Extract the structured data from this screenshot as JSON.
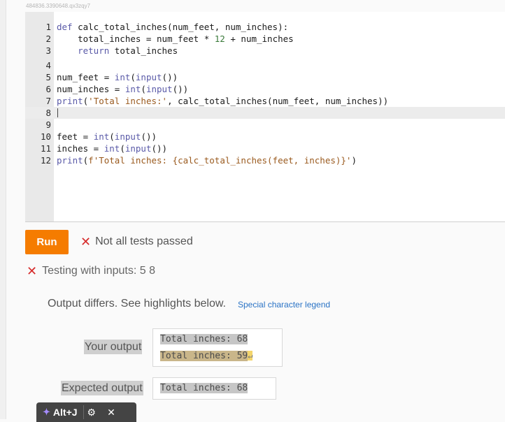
{
  "watermark": "484836.3390648.qx3zqy7",
  "editor": {
    "lines": [
      {
        "n": "1",
        "code": "def calc_total_inches(num_feet, num_inches):"
      },
      {
        "n": "2",
        "code": "    total_inches = num_feet * 12 + num_inches"
      },
      {
        "n": "3",
        "code": "    return total_inches"
      },
      {
        "n": "4",
        "code": ""
      },
      {
        "n": "5",
        "code": "num_feet = int(input())"
      },
      {
        "n": "6",
        "code": "num_inches = int(input())"
      },
      {
        "n": "7",
        "code": "print('Total inches:', calc_total_inches(num_feet, num_inches))"
      },
      {
        "n": "8",
        "code": ""
      },
      {
        "n": "9",
        "code": ""
      },
      {
        "n": "10",
        "code": "feet = int(input())"
      },
      {
        "n": "11",
        "code": "inches = int(input())"
      },
      {
        "n": "12",
        "code": "print(f'Total inches: {calc_total_inches(feet, inches)}')"
      }
    ],
    "active_line": "8"
  },
  "run": {
    "button_label": "Run",
    "status_text": "Not all tests passed",
    "fail_icon": "x-icon"
  },
  "test": {
    "testing_text": "Testing with inputs: 5 8",
    "differs_text": "Output differs. See highlights below.",
    "legend_link": "Special character legend",
    "your_output_label": "Your output",
    "your_output_lines": [
      "Total inches: 68",
      "Total inches: 59"
    ],
    "newline_symbol": "↵",
    "expected_output_label": "Expected output",
    "expected_output_lines": [
      "Total inches: 68"
    ]
  },
  "toolbar": {
    "sparkle_icon": "sparkle-icon",
    "shortcut": "Alt+J",
    "gear_icon": "gear-icon",
    "close_icon": "close-icon"
  },
  "colors": {
    "run_button": "#f57c00",
    "fail_red": "#d62b2b",
    "link_blue": "#2a73c5",
    "diff_highlight": "#c9b68a",
    "newline_highlight": "#f3d56c"
  }
}
